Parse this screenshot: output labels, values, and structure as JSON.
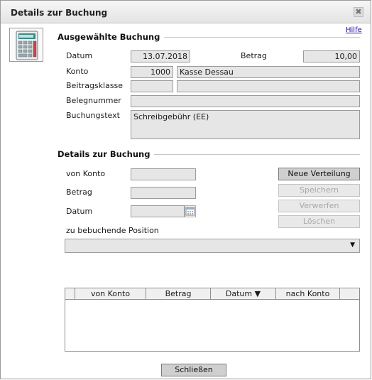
{
  "window": {
    "title": "Details zur Buchung",
    "close_symbol": "✖"
  },
  "help": {
    "label": "Hilfe"
  },
  "selected": {
    "section_title": "Ausgewählte Buchung",
    "datum": {
      "label": "Datum",
      "value": "13.07.2018"
    },
    "betrag": {
      "label": "Betrag",
      "value": "10,00"
    },
    "konto": {
      "label": "Konto",
      "number": "1000",
      "name": "Kasse Dessau"
    },
    "beitragsklasse": {
      "label": "Beitragsklasse",
      "code": "",
      "name": ""
    },
    "belegnummer": {
      "label": "Belegnummer",
      "value": ""
    },
    "buchungstext": {
      "label": "Buchungstext",
      "value": "Schreibgebühr (EE)"
    }
  },
  "details": {
    "section_title": "Details zur Buchung",
    "von_konto": {
      "label": "von Konto",
      "value": ""
    },
    "betrag": {
      "label": "Betrag",
      "value": ""
    },
    "datum": {
      "label": "Datum",
      "value": ""
    },
    "position": {
      "label": "zu bebuchende Position",
      "selected": "",
      "arrow": "▼"
    }
  },
  "buttons": {
    "neue_verteilung": "Neue Verteilung",
    "speichern": "Speichern",
    "verwerfen": "Verwerfen",
    "loeschen": "Löschen",
    "schliessen": "Schließen"
  },
  "table": {
    "columns": [
      "",
      "von Konto",
      "Betrag",
      "Datum ▼",
      "nach Konto",
      ""
    ],
    "rows": []
  }
}
